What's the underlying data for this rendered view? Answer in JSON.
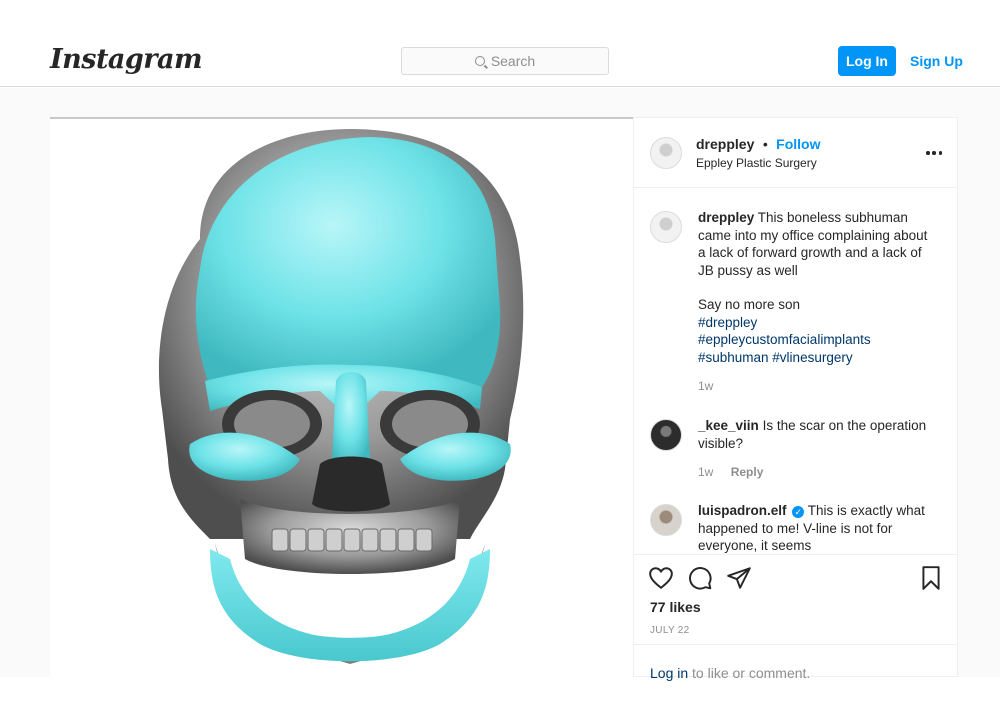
{
  "header": {
    "logo": "Instagram",
    "search_placeholder": "Search",
    "login_label": "Log In",
    "signup_label": "Sign Up"
  },
  "colors": {
    "accent": "#0095f6",
    "implant": "#6ee7ec",
    "bone": "#8f8f8f"
  },
  "post": {
    "author": "dreppley",
    "separator": "•",
    "follow_label": "Follow",
    "location": "Eppley Plastic Surgery",
    "image_description_icon": "skull-3d-icon",
    "caption": {
      "author": "dreppley",
      "text": "This boneless subhuman came into my office complaining about a lack of forward growth and a lack of JB pussy as well",
      "line2": "Say no more son",
      "hashtags": [
        "#dreppley",
        "#eppleycustomfacialimplants",
        "#subhuman #vlinesurgery"
      ],
      "time": "1w"
    },
    "comments": [
      {
        "user": "_kee_viin",
        "text": "Is the scar on the operation visible?",
        "time": "1w",
        "reply_label": "Reply"
      },
      {
        "user": "luispadron.elf",
        "verified_mark": "✓",
        "text": "This is exactly what happened to me! V-line is not for everyone, it seems"
      }
    ],
    "likes": "77 likes",
    "date": "JULY 22",
    "footer": {
      "login_link": "Log in",
      "rest": " to like or comment."
    }
  }
}
